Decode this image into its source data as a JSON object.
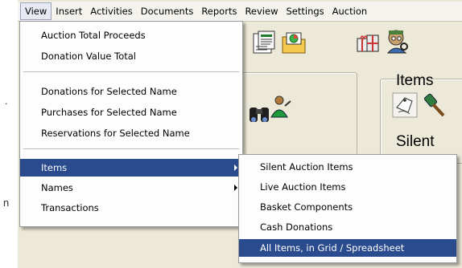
{
  "menubar": {
    "items": [
      "View",
      "Insert",
      "Activities",
      "Documents",
      "Reports",
      "Review",
      "Settings",
      "Auction"
    ]
  },
  "panels": {
    "items_title": "Items",
    "silent_title": "Silent"
  },
  "view_menu": {
    "items": [
      {
        "label": "Auction Total Proceeds"
      },
      {
        "label": "Donation Value Total"
      },
      {
        "label": "Donations for Selected Name"
      },
      {
        "label": "Purchases for Selected Name"
      },
      {
        "label": "Reservations for Selected Name"
      },
      {
        "label": "Items",
        "selected": true,
        "submenu": true
      },
      {
        "label": "Names",
        "submenu": true
      },
      {
        "label": "Transactions"
      }
    ]
  },
  "items_submenu": {
    "items": [
      {
        "label": "Silent Auction Items"
      },
      {
        "label": "Live Auction Items"
      },
      {
        "label": "Basket Components"
      },
      {
        "label": "Cash Donations"
      },
      {
        "label": "All Items, in Grid / Spreadsheet",
        "selected": true
      }
    ]
  },
  "colors": {
    "selection": "#2a4b8d",
    "window": "#ece9d8"
  },
  "icons": [
    "document-list-icon",
    "folder-chart-icon",
    "gift-icon",
    "person-search-icon",
    "binoculars-icon",
    "person-icon",
    "item-tag-icon",
    "gavel-icon"
  ]
}
